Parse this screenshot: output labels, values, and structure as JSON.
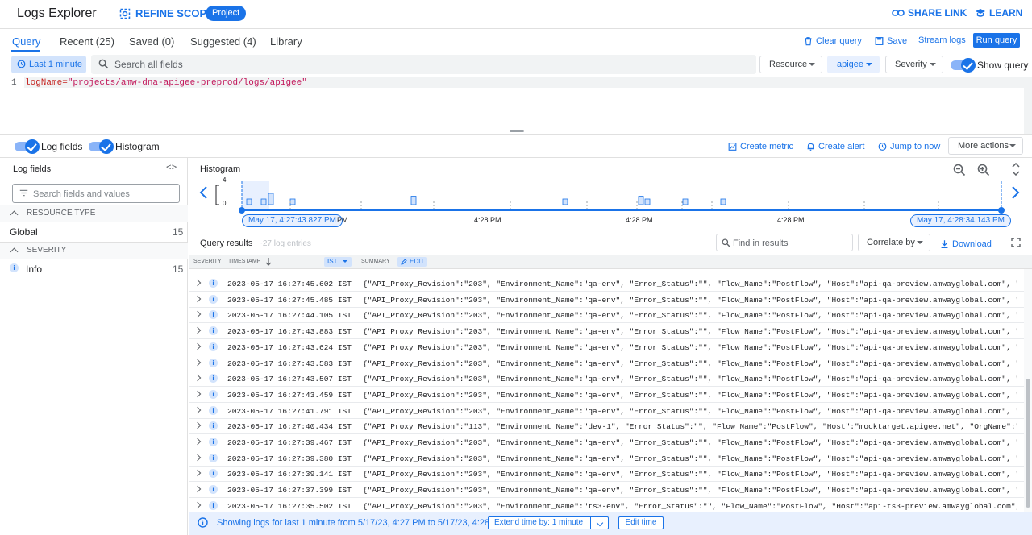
{
  "header": {
    "title": "Logs Explorer",
    "refine_scope": "REFINE SCOPE",
    "project_chip": "Project",
    "share_link": "SHARE LINK",
    "learn": "LEARN"
  },
  "tabs": [
    {
      "label": "Query",
      "active": true
    },
    {
      "label": "Recent (25)"
    },
    {
      "label": "Saved (0)"
    },
    {
      "label": "Suggested (4)"
    },
    {
      "label": "Library"
    }
  ],
  "query_actions": {
    "clear": "Clear query",
    "save": "Save",
    "stream": "Stream logs",
    "run": "Run query"
  },
  "filter_bar": {
    "time": "Last 1 minute",
    "search_placeholder": "Search all fields",
    "resource": "Resource",
    "apigee": "apigee",
    "severity": "Severity",
    "show_query": "Show query"
  },
  "editor": {
    "line_number": "1",
    "query_key": "logName=",
    "query_value": "\"projects/amw-dna-apigee-preprod/logs/apigee\""
  },
  "toolbar": {
    "log_fields": "Log fields",
    "histogram": "Histogram",
    "create_metric": "Create metric",
    "create_alert": "Create alert",
    "jump_to_now": "Jump to now",
    "more_actions": "More actions"
  },
  "log_fields_panel": {
    "title": "Log fields",
    "code_icon": "<>",
    "search_placeholder": "Search fields and values",
    "resource_type_header": "RESOURCE TYPE",
    "resource_items": [
      {
        "label": "Global",
        "count": "15"
      }
    ],
    "severity_header": "SEVERITY",
    "severity_items": [
      {
        "label": "Info",
        "count": "15"
      }
    ]
  },
  "histogram": {
    "title": "Histogram",
    "y_max": "4",
    "y_min": "0",
    "start_label": "May 17, 4:27:43.827 PM",
    "end_label": "May 17, 4:28:34.143 PM",
    "partial_tick": "PM",
    "ticks": [
      "4:28 PM",
      "4:28 PM",
      "4:28 PM"
    ],
    "bars": [
      1,
      1,
      2,
      1,
      1.5,
      1,
      1.5,
      1,
      1,
      1
    ]
  },
  "results": {
    "title": "Query results",
    "count": "~27 log entries",
    "find_placeholder": "Find in results",
    "correlate": "Correlate by",
    "download": "Download"
  },
  "table": {
    "col_severity": "SEVERITY",
    "col_timestamp": "TIMESTAMP",
    "tz": "IST",
    "col_summary": "SUMMARY",
    "edit": "EDIT",
    "rows": [
      {
        "ts": "2023-05-17 16:27:45.602 IST",
        "summary": "{\"API_Proxy_Revision\":\"203\", \"Environment_Name\":\"qa-env\", \"Error_Status\":\"\", \"Flow_Name\":\"PostFlow\", \"Host\":\"api-qa-preview.amwayglobal.com\", \"OrgName\":\"a…"
      },
      {
        "ts": "2023-05-17 16:27:45.485 IST",
        "summary": "{\"API_Proxy_Revision\":\"203\", \"Environment_Name\":\"qa-env\", \"Error_Status\":\"\", \"Flow_Name\":\"PostFlow\", \"Host\":\"api-qa-preview.amwayglobal.com\", \"OrgName\":\"a…"
      },
      {
        "ts": "2023-05-17 16:27:44.105 IST",
        "summary": "{\"API_Proxy_Revision\":\"203\", \"Environment_Name\":\"qa-env\", \"Error_Status\":\"\", \"Flow_Name\":\"PostFlow\", \"Host\":\"api-qa-preview.amwayglobal.com\", \"OrgName\":\"a…"
      },
      {
        "ts": "2023-05-17 16:27:43.883 IST",
        "summary": "{\"API_Proxy_Revision\":\"203\", \"Environment_Name\":\"qa-env\", \"Error_Status\":\"\", \"Flow_Name\":\"PostFlow\", \"Host\":\"api-qa-preview.amwayglobal.com\", \"OrgName\":\"a…"
      },
      {
        "ts": "2023-05-17 16:27:43.624 IST",
        "summary": "{\"API_Proxy_Revision\":\"203\", \"Environment_Name\":\"qa-env\", \"Error_Status\":\"\", \"Flow_Name\":\"PostFlow\", \"Host\":\"api-qa-preview.amwayglobal.com\", \"OrgName\":\"a…"
      },
      {
        "ts": "2023-05-17 16:27:43.583 IST",
        "summary": "{\"API_Proxy_Revision\":\"203\", \"Environment_Name\":\"qa-env\", \"Error_Status\":\"\", \"Flow_Name\":\"PostFlow\", \"Host\":\"api-qa-preview.amwayglobal.com\", \"OrgName\":\"a…"
      },
      {
        "ts": "2023-05-17 16:27:43.507 IST",
        "summary": "{\"API_Proxy_Revision\":\"203\", \"Environment_Name\":\"qa-env\", \"Error_Status\":\"\", \"Flow_Name\":\"PostFlow\", \"Host\":\"api-qa-preview.amwayglobal.com\", \"OrgName\":\"a…"
      },
      {
        "ts": "2023-05-17 16:27:43.459 IST",
        "summary": "{\"API_Proxy_Revision\":\"203\", \"Environment_Name\":\"qa-env\", \"Error_Status\":\"\", \"Flow_Name\":\"PostFlow\", \"Host\":\"api-qa-preview.amwayglobal.com\", \"OrgName\":\"a…"
      },
      {
        "ts": "2023-05-17 16:27:41.791 IST",
        "summary": "{\"API_Proxy_Revision\":\"203\", \"Environment_Name\":\"qa-env\", \"Error_Status\":\"\", \"Flow_Name\":\"PostFlow\", \"Host\":\"api-qa-preview.amwayglobal.com\", \"OrgName\":\"a…"
      },
      {
        "ts": "2023-05-17 16:27:40.434 IST",
        "summary": "{\"API_Proxy_Revision\":\"113\", \"Environment_Name\":\"dev-1\", \"Error_Status\":\"\", \"Flow_Name\":\"PostFlow\", \"Host\":\"mocktarget.apigee.net\", \"OrgName\":\"amw-dna-api…"
      },
      {
        "ts": "2023-05-17 16:27:39.467 IST",
        "summary": "{\"API_Proxy_Revision\":\"203\", \"Environment_Name\":\"qa-env\", \"Error_Status\":\"\", \"Flow_Name\":\"PostFlow\", \"Host\":\"api-qa-preview.amwayglobal.com\", \"OrgName\":\"a…"
      },
      {
        "ts": "2023-05-17 16:27:39.380 IST",
        "summary": "{\"API_Proxy_Revision\":\"203\", \"Environment_Name\":\"qa-env\", \"Error_Status\":\"\", \"Flow_Name\":\"PostFlow\", \"Host\":\"api-qa-preview.amwayglobal.com\", \"OrgName\":\"a…"
      },
      {
        "ts": "2023-05-17 16:27:39.141 IST",
        "summary": "{\"API_Proxy_Revision\":\"203\", \"Environment_Name\":\"qa-env\", \"Error_Status\":\"\", \"Flow_Name\":\"PostFlow\", \"Host\":\"api-qa-preview.amwayglobal.com\", \"OrgName\":\"a…"
      },
      {
        "ts": "2023-05-17 16:27:37.399 IST",
        "summary": "{\"API_Proxy_Revision\":\"203\", \"Environment_Name\":\"qa-env\", \"Error_Status\":\"\", \"Flow_Name\":\"PostFlow\", \"Host\":\"api-qa-preview.amwayglobal.com\", \"OrgName\":\"a…"
      },
      {
        "ts": "2023-05-17 16:27:35.502 IST",
        "summary": "{\"API_Proxy_Revision\":\"203\", \"Environment_Name\":\"ts3-env\", \"Error_Status\":\"\", \"Flow_Name\":\"PostFlow\", \"Host\":\"api-ts3-preview.amwayglobal.com\", \"OrgName\":\"…"
      }
    ]
  },
  "footer": {
    "text": "Showing logs for last 1 minute from 5/17/23, 4:27 PM to 5/17/23, 4:28 PM.",
    "extend": "Extend time by: 1 minute",
    "edit_time": "Edit time"
  },
  "colors": {
    "accent": "#1a73e8",
    "chip_bg": "#d2e3fc"
  }
}
